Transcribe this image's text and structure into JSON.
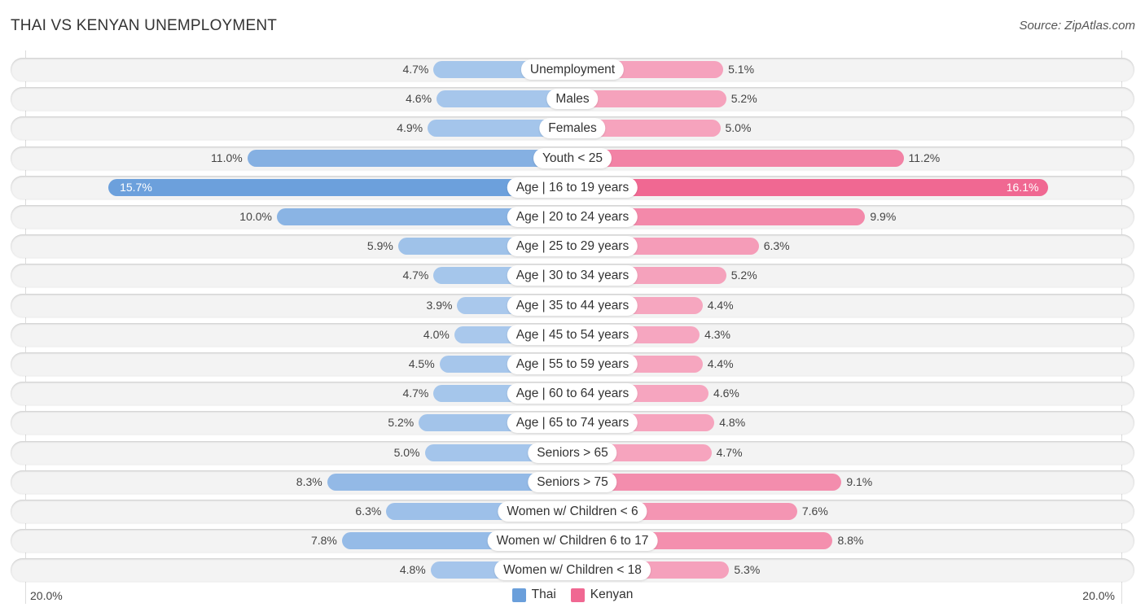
{
  "header": {
    "title": "THAI VS KENYAN UNEMPLOYMENT",
    "source": "Source: ZipAtlas.com"
  },
  "colors": {
    "thai": "#6a9fdb",
    "thai_light": "#a9c8ec",
    "kenyan": "#f06892",
    "kenyan_light": "#f6a8c1"
  },
  "chart_data": {
    "type": "bar",
    "orientation": "horizontal-diverging",
    "title": "THAI VS KENYAN UNEMPLOYMENT",
    "categories": [
      "Unemployment",
      "Males",
      "Females",
      "Youth < 25",
      "Age | 16 to 19 years",
      "Age | 20 to 24 years",
      "Age | 25 to 29 years",
      "Age | 30 to 34 years",
      "Age | 35 to 44 years",
      "Age | 45 to 54 years",
      "Age | 55 to 59 years",
      "Age | 60 to 64 years",
      "Age | 65 to 74 years",
      "Seniors > 65",
      "Seniors > 75",
      "Women w/ Children < 6",
      "Women w/ Children 6 to 17",
      "Women w/ Children < 18"
    ],
    "series": [
      {
        "name": "Thai",
        "side": "left",
        "values": [
          4.7,
          4.6,
          4.9,
          11.0,
          15.7,
          10.0,
          5.9,
          4.7,
          3.9,
          4.0,
          4.5,
          4.7,
          5.2,
          5.0,
          8.3,
          6.3,
          7.8,
          4.8
        ],
        "labels": [
          "4.7%",
          "4.6%",
          "4.9%",
          "11.0%",
          "15.7%",
          "10.0%",
          "5.9%",
          "4.7%",
          "3.9%",
          "4.0%",
          "4.5%",
          "4.7%",
          "5.2%",
          "5.0%",
          "8.3%",
          "6.3%",
          "7.8%",
          "4.8%"
        ]
      },
      {
        "name": "Kenyan",
        "side": "right",
        "values": [
          5.1,
          5.2,
          5.0,
          11.2,
          16.1,
          9.9,
          6.3,
          5.2,
          4.4,
          4.3,
          4.4,
          4.6,
          4.8,
          4.7,
          9.1,
          7.6,
          8.8,
          5.3
        ],
        "labels": [
          "5.1%",
          "5.2%",
          "5.0%",
          "11.2%",
          "16.1%",
          "9.9%",
          "6.3%",
          "5.2%",
          "4.4%",
          "4.3%",
          "4.4%",
          "4.6%",
          "4.8%",
          "4.7%",
          "9.1%",
          "7.6%",
          "8.8%",
          "5.3%"
        ]
      }
    ],
    "axis": {
      "min_label": "20.0%",
      "max_label": "20.0%",
      "range": [
        -20,
        20
      ]
    },
    "legend": {
      "position": "bottom-center",
      "items": [
        "Thai",
        "Kenyan"
      ]
    }
  }
}
